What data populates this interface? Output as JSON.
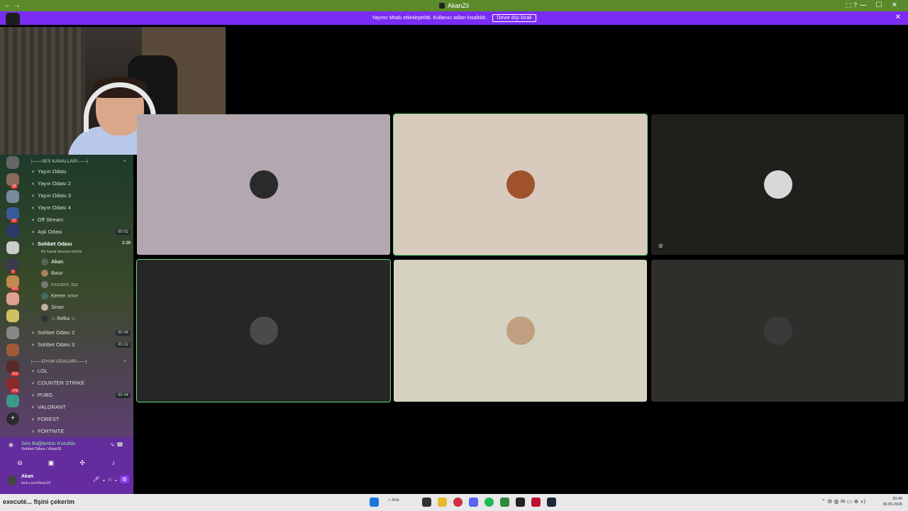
{
  "titlebar": {
    "title": "AkanZil",
    "nav": "← →",
    "window_controls": [
      "—",
      "☐",
      "✕"
    ],
    "extra_icons": "⬚ ?"
  },
  "streamer_bar": {
    "message": "Yayıncı Modu etkinleştirildi. Kullanıcı adları kısaltıldı.",
    "button": "Devre dışı bırak",
    "close": "✕"
  },
  "guilds": [
    {
      "badge": "",
      "color": "#666"
    },
    {
      "badge": "28",
      "color": "#8a6a5a"
    },
    {
      "badge": "",
      "color": "#7a8a9a"
    },
    {
      "badge": "21",
      "color": "#3a5a9a"
    },
    {
      "badge": "",
      "color": "#2a3a6a"
    },
    {
      "badge": "",
      "color": "#ccc"
    },
    {
      "badge": "5",
      "color": "#3a3a4a"
    },
    {
      "badge": "431",
      "color": "#c08a4a"
    },
    {
      "badge": "",
      "color": "#e0a090"
    },
    {
      "badge": "",
      "color": "#d0c060"
    },
    {
      "badge": "",
      "color": "#888"
    },
    {
      "badge": "",
      "color": "#a05a3a"
    },
    {
      "badge": "119",
      "color": "#5a2a2a"
    },
    {
      "badge": "279",
      "color": "#8a2a2a"
    },
    {
      "badge": "",
      "color": "#3a9a8a"
    }
  ],
  "categories": {
    "voice": "|——SES KANALLARI——|",
    "games": "|——OYUN ODALARI——|",
    "plus": "+"
  },
  "channels": {
    "yayin1": "Yayın Odası",
    "yayin2": "Yayın Odası 2",
    "yayin3": "Yayın Odası 3",
    "yayin4": "Yayın Odası 4",
    "offstream": "Off Stream",
    "ask": "Aşk Odası",
    "ask_count": "00 02",
    "sohbet": "Sohbet Odası",
    "sohbet_time": "3:39",
    "sohbet_sub": "Bir kanal durumu belirle",
    "sohbet2": "Sohbet Odası 2",
    "sohbet2_count": "00 06",
    "sohbet3": "Sohbet Odası 3",
    "sohbet3_count": "00 02",
    "lol": "LOL",
    "cs": "COUNTER STRIKE",
    "pubg": "PUBG",
    "pubg_count": "00 04",
    "valorant": "VALORANT",
    "forest": "FOREST",
    "fortnite": "FORTNITE"
  },
  "users": {
    "u1": "Akan",
    "u2": "Batur",
    "u3": "exurann",
    "u3_tag": "113",
    "u4": "Kerem",
    "u4_tag": "NTRY",
    "u5": "Sinan",
    "u6": "☆ Relka ☆"
  },
  "voice_panel": {
    "status": "Ses Bağlantısı Kuruldu",
    "location": "Sohbet Odası / AkanZil",
    "me_name": "Akan",
    "me_sub": "kick.com/AkanZil"
  },
  "tiles": [
    {
      "bg": "#b4a8b0",
      "avatar": "#2a2a2a",
      "speaking": false
    },
    {
      "bg": "#d8cbbd",
      "avatar": "#a0522d",
      "speaking": true
    },
    {
      "bg": "#1f201c",
      "avatar": "#d8d8d8",
      "speaking": false
    },
    {
      "bg": "#262626",
      "avatar": "#4a4a4a",
      "speaking": true
    },
    {
      "bg": "#d6d2c2",
      "avatar": "#c0a080",
      "speaking": false
    },
    {
      "bg": "#302e2b",
      "avatar": "#3a3a3a",
      "speaking": false
    }
  ],
  "taskbar": {
    "search": "Ara",
    "clock_time": "20:49",
    "clock_date": "30.05.2026",
    "notification_text": "executé... fişini çekerim"
  }
}
